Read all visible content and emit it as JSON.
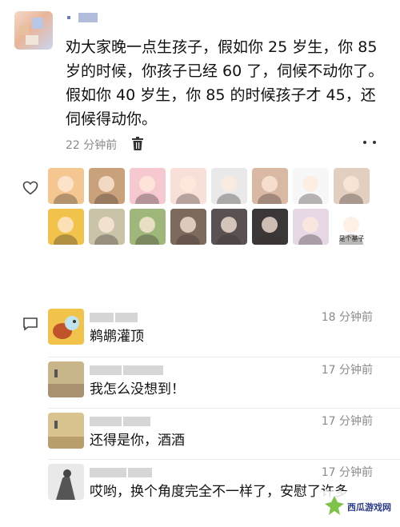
{
  "post": {
    "text": "劝大家晚一点生孩子，假如你 25 岁生，你 85 岁的时候，你孩子已经 60 了，伺候不动你了。假如你 40 岁生，你 85 的时候孩子才 45，还伺候得动你。",
    "time": "22 分钟前",
    "icons": {
      "delete": "trash-icon",
      "more": "more-icon",
      "like": "heart-icon",
      "comment": "comment-icon"
    }
  },
  "likers": [
    {
      "name": "liker-1",
      "bg": "#f3c78f",
      "caption": ""
    },
    {
      "name": "liker-2",
      "bg": "#c9a27c",
      "caption": ""
    },
    {
      "name": "liker-3",
      "bg": "#f5c9cf",
      "caption": ""
    },
    {
      "name": "liker-4",
      "bg": "#f8e0d8",
      "caption": ""
    },
    {
      "name": "liker-5",
      "bg": "#e9e9e9",
      "caption": ""
    },
    {
      "name": "liker-6",
      "bg": "#d9b9a3",
      "caption": ""
    },
    {
      "name": "liker-7",
      "bg": "#f7f7f7",
      "caption": ""
    },
    {
      "name": "liker-8",
      "bg": "#e3cfc0",
      "caption": ""
    },
    {
      "name": "liker-9",
      "bg": "#f2c34a",
      "caption": ""
    },
    {
      "name": "liker-10",
      "bg": "#c9c4a8",
      "caption": ""
    },
    {
      "name": "liker-11",
      "bg": "#9fb77a",
      "caption": ""
    },
    {
      "name": "liker-12",
      "bg": "#7d6a5d",
      "caption": ""
    },
    {
      "name": "liker-13",
      "bg": "#5a5252",
      "caption": ""
    },
    {
      "name": "liker-14",
      "bg": "#3b3638",
      "caption": ""
    },
    {
      "name": "liker-15",
      "bg": "#e7d8e6",
      "caption": ""
    },
    {
      "name": "liker-16",
      "bg": "#ffffff",
      "caption": "是个基子"
    }
  ],
  "comments": [
    {
      "time": "18 分钟前",
      "text": "鹈鹕灌顶",
      "avatar_bg": "#f2c34a"
    },
    {
      "time": "17 分钟前",
      "text": "我怎么没想到！",
      "avatar_bg": "#c8b68a"
    },
    {
      "time": "17 分钟前",
      "text": "还得是你，酒酒",
      "avatar_bg": "#d9c48f"
    },
    {
      "time": "17 分钟前",
      "text": "哎哟，换个角度完全不一样了，安慰了许多",
      "avatar_bg": "#9a9a9a"
    }
  ],
  "watermark": {
    "text": "西瓜游戏网"
  },
  "colors": {
    "bg": "#ffffff",
    "meta": "#8a8a8a",
    "text": "#111111"
  }
}
